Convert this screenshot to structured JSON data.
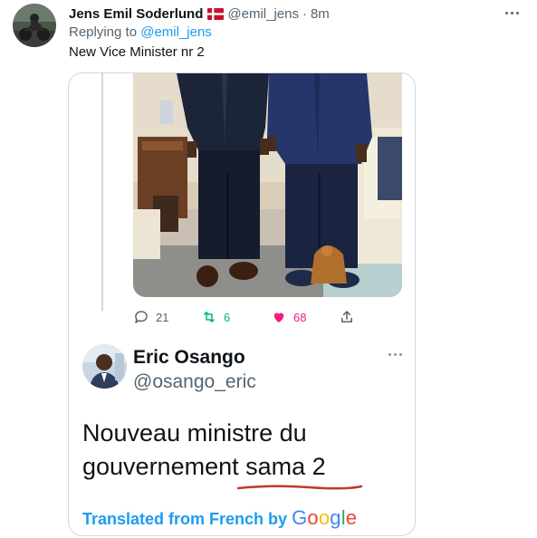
{
  "tweet": {
    "author": {
      "display_name": "Jens Emil Soderlund",
      "flag_icon": "denmark-flag-icon",
      "handle": "@emil_jens",
      "separator": "·",
      "time": "8m",
      "avatar_icon": "motorcycle-avatar"
    },
    "replying_prefix": "Replying to",
    "replying_to": "@emil_jens",
    "text": "New Vice Minister nr 2",
    "more_icon": "more-horizontal-icon"
  },
  "embedded": {
    "photo_icon": "two-men-in-suits-photo",
    "actions": {
      "reply_count": "21",
      "retweet_count": "6",
      "like_count": "68"
    },
    "quoted": {
      "display_name": "Eric Osango",
      "handle": "@osango_eric",
      "line1": "Nouveau ministre du",
      "line2": "gouvernement sama 2",
      "translated_label": "Translated from French by",
      "google": [
        "G",
        "o",
        "o",
        "g",
        "l",
        "e"
      ]
    }
  },
  "colors": {
    "accent": "#1d9bf0",
    "retweet": "#00ba7c",
    "like": "#f91880",
    "muted": "#536471",
    "underline": "#c0392b"
  }
}
